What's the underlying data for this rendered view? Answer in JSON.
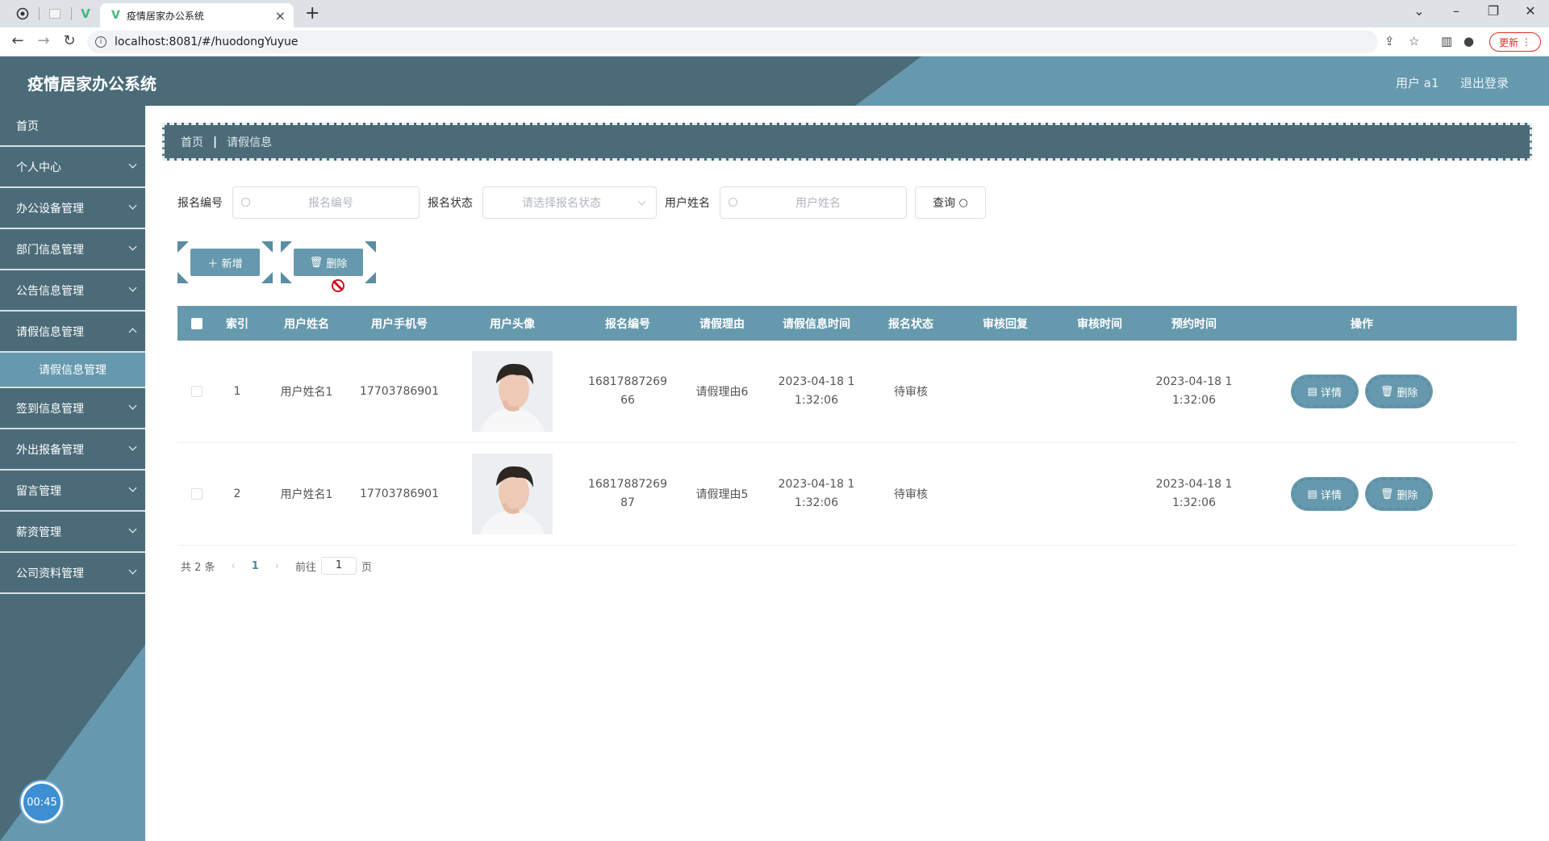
{
  "browser": {
    "tab_title": "疫情居家办公系统",
    "url": "localhost:8081/#/huodongYuyue",
    "update_label": "更新"
  },
  "header": {
    "app_title": "疫情居家办公系统",
    "user_label": "用户 a1",
    "logout_label": "退出登录"
  },
  "sidebar": {
    "items": [
      {
        "label": "首页"
      },
      {
        "label": "个人中心"
      },
      {
        "label": "办公设备管理"
      },
      {
        "label": "部门信息管理"
      },
      {
        "label": "公告信息管理"
      },
      {
        "label": "请假信息管理"
      },
      {
        "label": "签到信息管理"
      },
      {
        "label": "外出报备管理"
      },
      {
        "label": "留言管理"
      },
      {
        "label": "薪资管理"
      },
      {
        "label": "公司资料管理"
      }
    ],
    "subitem": "请假信息管理",
    "timer": "00:45"
  },
  "breadcrumb": {
    "home": "首页",
    "current": "请假信息"
  },
  "search": {
    "field1_label": "报名编号",
    "field1_placeholder": "报名编号",
    "field2_label": "报名状态",
    "field2_placeholder": "请选择报名状态",
    "field3_label": "用户姓名",
    "field3_placeholder": "用户姓名",
    "query_label": "查询"
  },
  "actions": {
    "add_label": "新增",
    "delete_label": "删除"
  },
  "table": {
    "headers": [
      "索引",
      "用户姓名",
      "用户手机号",
      "用户头像",
      "报名编号",
      "请假理由",
      "请假信息时间",
      "报名状态",
      "审核回复",
      "审核时间",
      "预约时间",
      "操作"
    ],
    "rows": [
      {
        "index": "1",
        "name": "用户姓名1",
        "phone": "17703786901",
        "code_a": "16817887269",
        "code_b": "66",
        "reason": "请假理由6",
        "time_a": "2023-04-18 1",
        "time_b": "1:32:06",
        "status": "待审核",
        "reply": "",
        "audit_time": "",
        "appt_a": "2023-04-18 1",
        "appt_b": "1:32:06"
      },
      {
        "index": "2",
        "name": "用户姓名1",
        "phone": "17703786901",
        "code_a": "16817887269",
        "code_b": "87",
        "reason": "请假理由5",
        "time_a": "2023-04-18 1",
        "time_b": "1:32:06",
        "status": "待审核",
        "reply": "",
        "audit_time": "",
        "appt_a": "2023-04-18 1",
        "appt_b": "1:32:06"
      }
    ],
    "detail_label": "详情",
    "delete_label": "删除"
  },
  "pagination": {
    "total": "共 2 条",
    "current": "1",
    "goto_prefix": "前往",
    "goto_value": "1",
    "goto_suffix": "页"
  }
}
